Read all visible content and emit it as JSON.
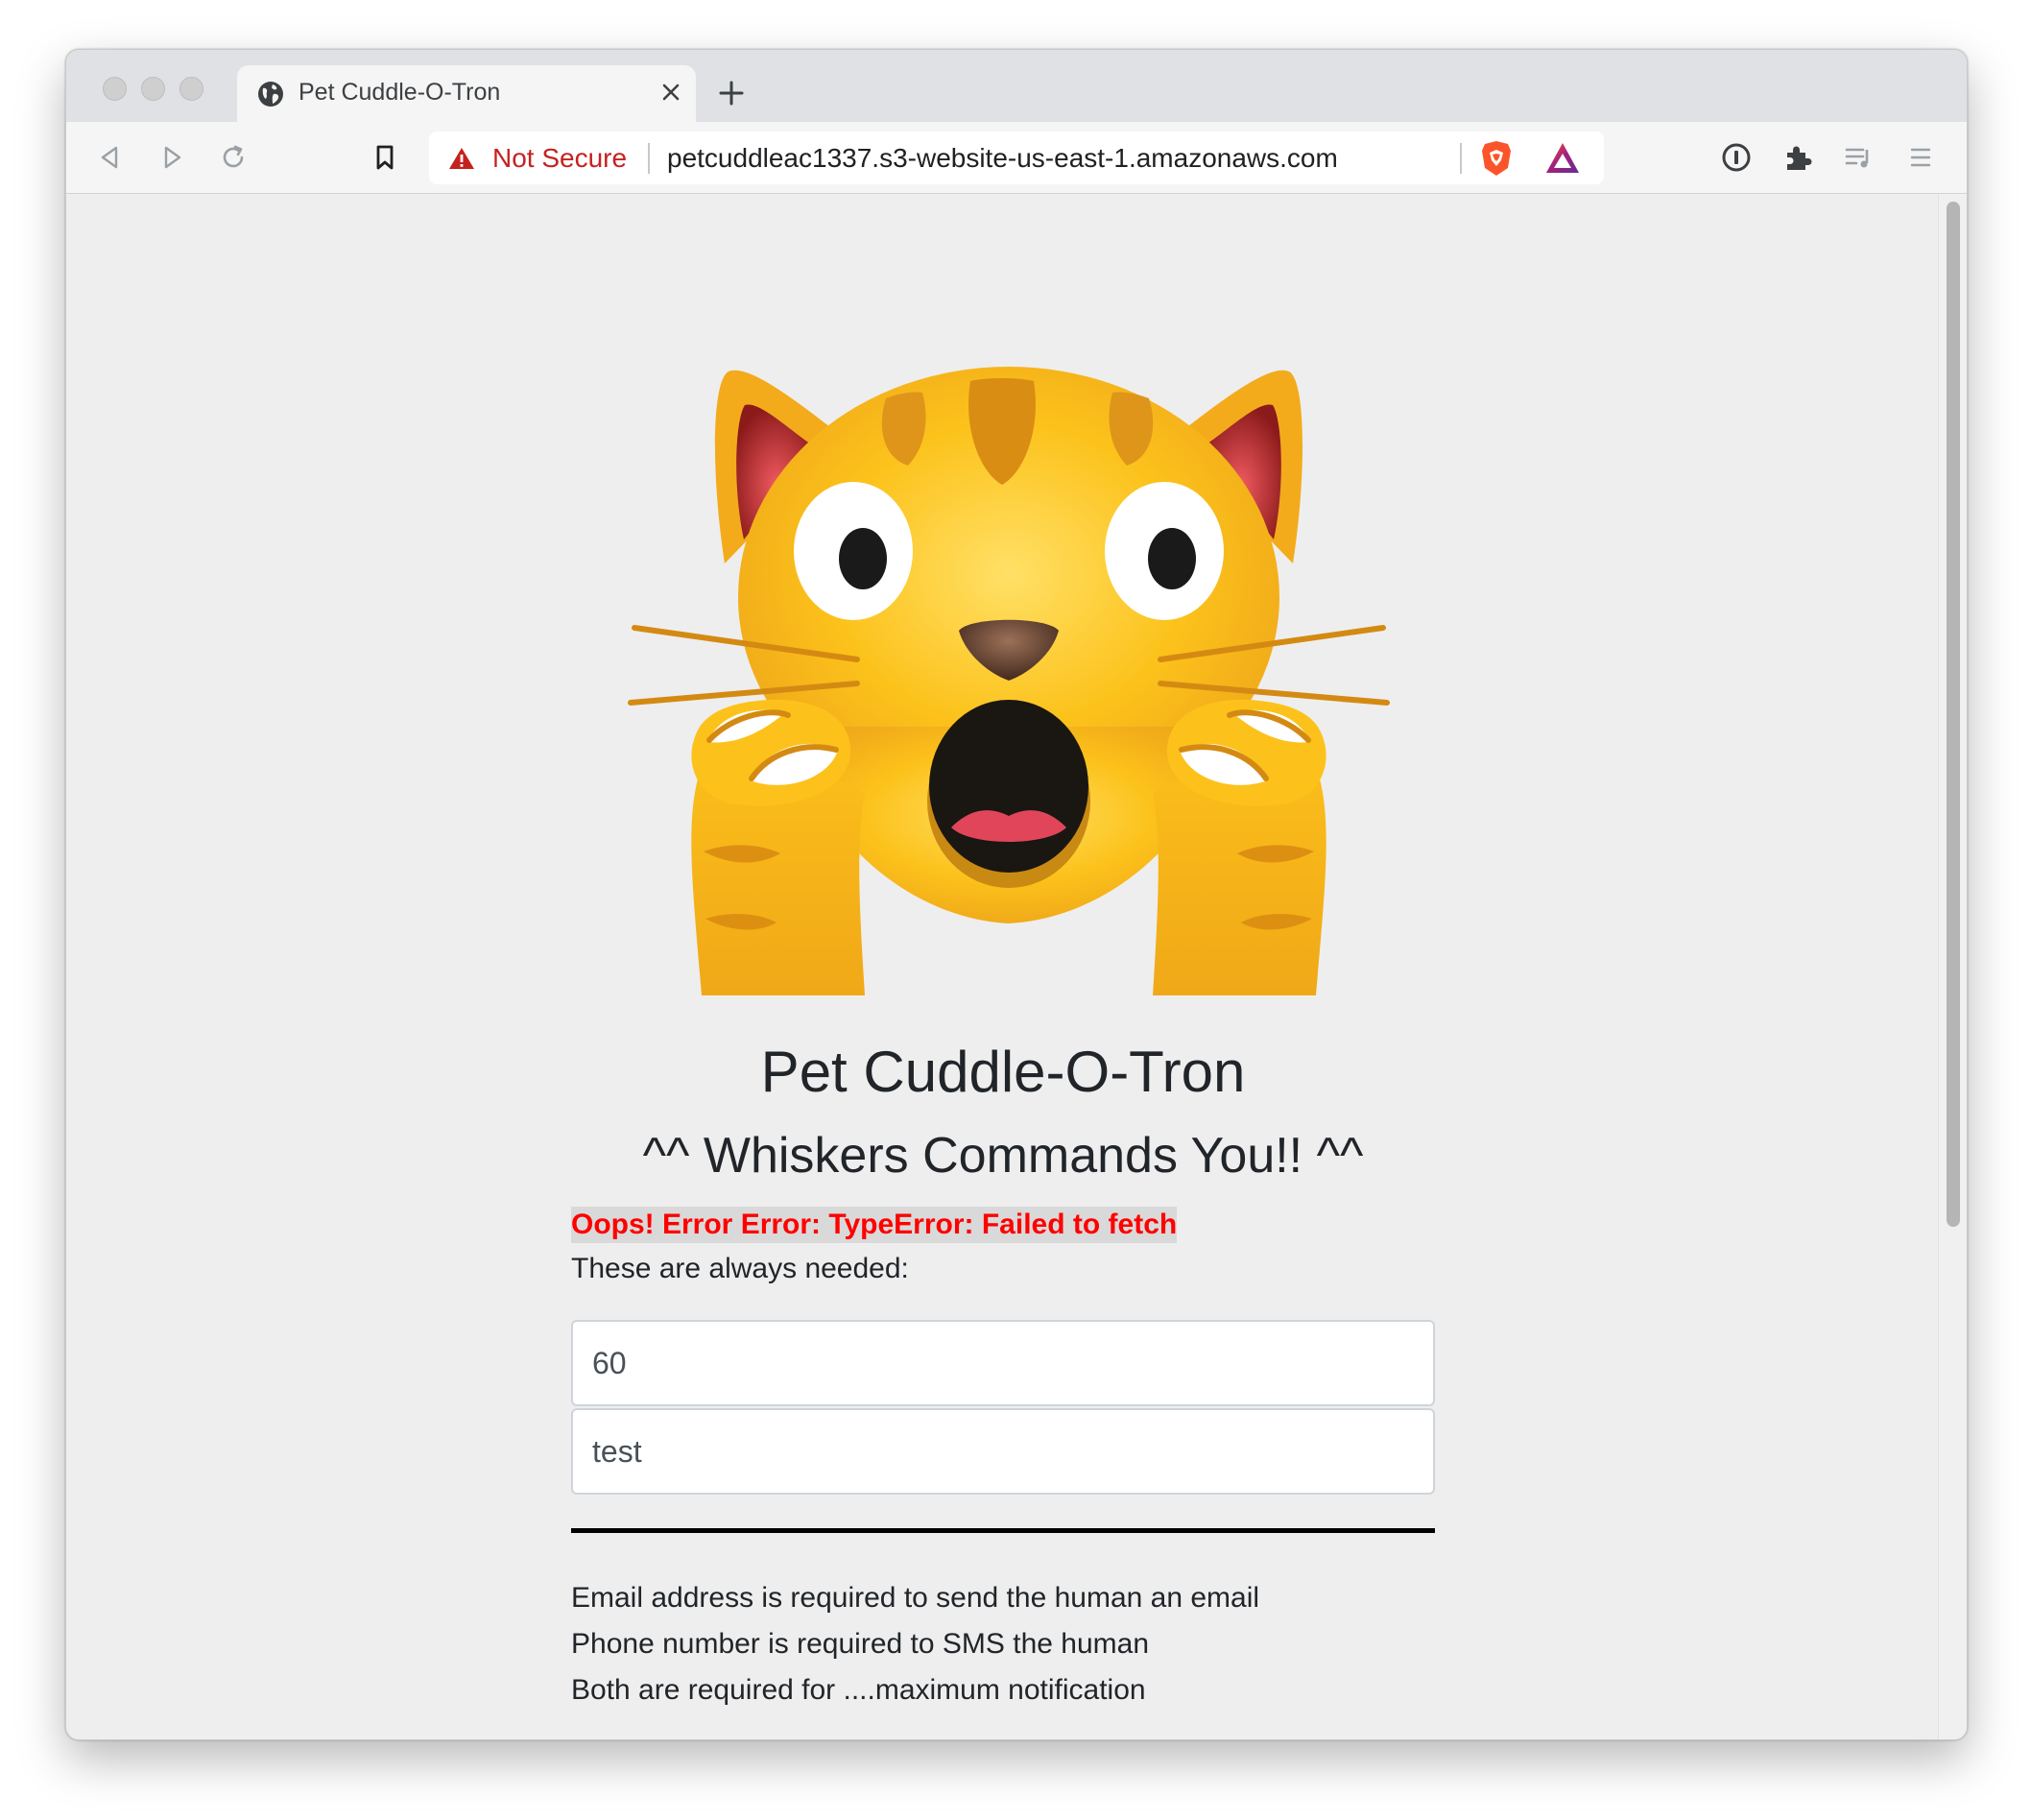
{
  "browser": {
    "tab": {
      "title": "Pet Cuddle-O-Tron"
    },
    "address_bar": {
      "security_label": "Not Secure",
      "url": "petcuddleac1337.s3-website-us-east-1.amazonaws.com"
    },
    "colors": {
      "not_secure": "#c5221f",
      "brave_orange": "#fb542b"
    }
  },
  "page": {
    "hero_image": "crying-cat-face-emoji",
    "title": "Pet Cuddle-O-Tron",
    "subtitle": "^^ Whiskers Commands You!! ^^",
    "error_message": "Oops! Error Error: TypeError: Failed to fetch",
    "required_label": "These are always needed:",
    "inputs": {
      "minutes_value": "60",
      "message_value": "test"
    },
    "notes": [
      "Email address is required to send the human an email",
      "Phone number is required to SMS the human",
      "Both are required for ....maximum notification"
    ],
    "colors": {
      "error_text": "#ff0000",
      "error_background": "#d9d9d9",
      "page_background": "#eeeeee"
    }
  }
}
